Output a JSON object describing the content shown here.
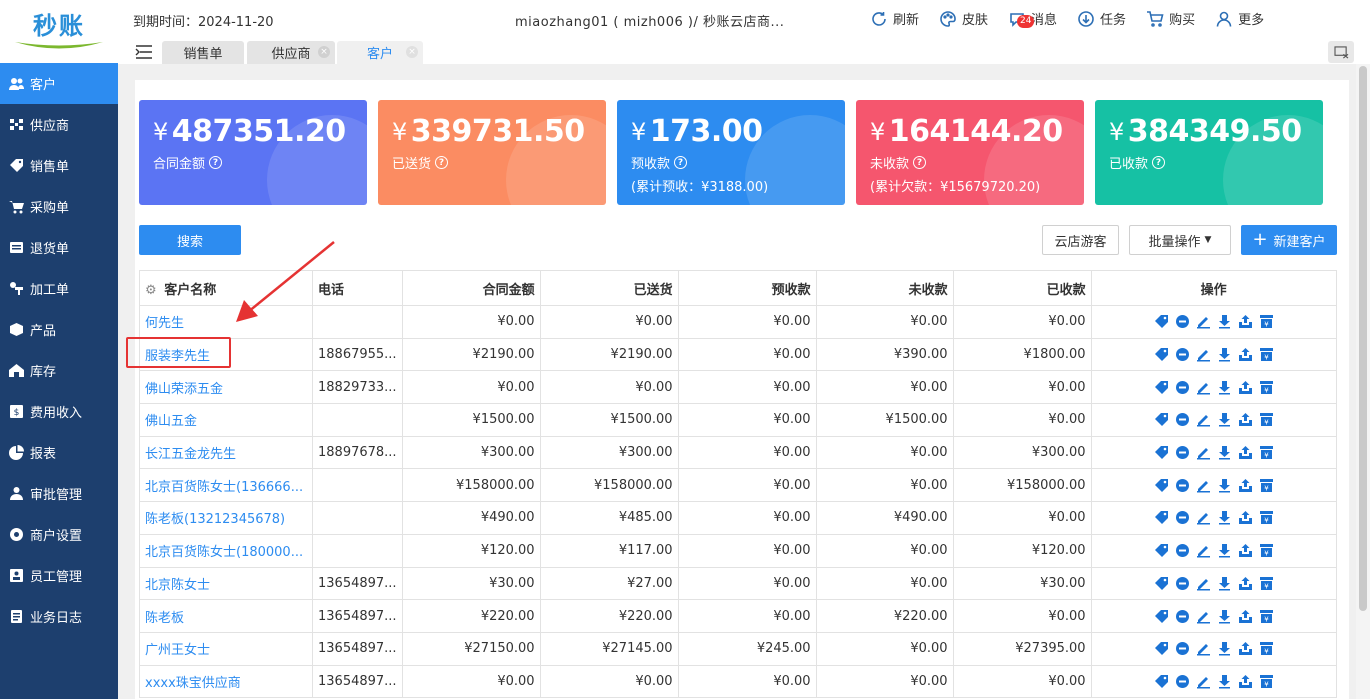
{
  "logo": {
    "text": "秒账"
  },
  "sidebar": {
    "items": [
      {
        "label": "客户",
        "icon": "users-icon",
        "active": true
      },
      {
        "label": "供应商",
        "icon": "supplier-icon"
      },
      {
        "label": "销售单",
        "icon": "tag-icon"
      },
      {
        "label": "采购单",
        "icon": "cart-icon"
      },
      {
        "label": "退货单",
        "icon": "return-icon"
      },
      {
        "label": "加工单",
        "icon": "process-icon"
      },
      {
        "label": "产品",
        "icon": "box-icon"
      },
      {
        "label": "库存",
        "icon": "warehouse-icon"
      },
      {
        "label": "费用收入",
        "icon": "expense-icon"
      },
      {
        "label": "报表",
        "icon": "pie-icon"
      },
      {
        "label": "审批管理",
        "icon": "approve-icon"
      },
      {
        "label": "商户设置",
        "icon": "gear-icon"
      },
      {
        "label": "员工管理",
        "icon": "staff-icon"
      },
      {
        "label": "业务日志",
        "icon": "log-icon"
      }
    ]
  },
  "header": {
    "expiry": "到期时间：2024-11-20",
    "account": "miaozhang01 ( mizh006 )/ 秒账云店商...",
    "tools": {
      "refresh": "刷新",
      "skin": "皮肤",
      "messages": "消息",
      "message_count": "24",
      "tasks": "任务",
      "buy": "购买",
      "more": "更多"
    }
  },
  "tabs": [
    {
      "label": "销售单"
    },
    {
      "label": "供应商"
    },
    {
      "label": "客户",
      "active": true
    }
  ],
  "cards": [
    {
      "currency": "¥",
      "amount": "487351.20",
      "label": "合同金额",
      "color": "#5b74f3"
    },
    {
      "currency": "¥",
      "amount": "339731.50",
      "label": "已送货",
      "color": "#fb8c62"
    },
    {
      "currency": "¥",
      "amount": "173.00",
      "label": "预收款",
      "sub": "(累计预收：¥3188.00)",
      "color": "#2d8cf0"
    },
    {
      "currency": "¥",
      "amount": "164144.20",
      "label": "未收款",
      "sub": "(累计欠款：¥15679720.20)",
      "color": "#f5566e"
    },
    {
      "currency": "¥",
      "amount": "384349.50",
      "label": "已收款",
      "color": "#16c1a4"
    }
  ],
  "actions": {
    "search": "搜索",
    "cloud_guest": "云店游客",
    "batch": "批量操作",
    "new_customer": "新建客户"
  },
  "table": {
    "columns": [
      "客户名称",
      "电话",
      "合同金额",
      "已送货",
      "预收款",
      "未收款",
      "已收款",
      "操作"
    ],
    "rows": [
      [
        "何先生",
        "",
        "¥0.00",
        "¥0.00",
        "¥0.00",
        "¥0.00",
        "¥0.00"
      ],
      [
        "服装李先生",
        "18867955...",
        "¥2190.00",
        "¥2190.00",
        "¥0.00",
        "¥390.00",
        "¥1800.00"
      ],
      [
        "佛山荣添五金",
        "18829733...",
        "¥0.00",
        "¥0.00",
        "¥0.00",
        "¥0.00",
        "¥0.00"
      ],
      [
        "佛山五金",
        "",
        "¥1500.00",
        "¥1500.00",
        "¥0.00",
        "¥1500.00",
        "¥0.00"
      ],
      [
        "长江五金龙先生",
        "18897678...",
        "¥300.00",
        "¥300.00",
        "¥0.00",
        "¥0.00",
        "¥300.00"
      ],
      [
        "北京百货陈女士(136666...",
        "",
        "¥158000.00",
        "¥158000.00",
        "¥0.00",
        "¥0.00",
        "¥158000.00"
      ],
      [
        "陈老板(13212345678)",
        "",
        "¥490.00",
        "¥485.00",
        "¥0.00",
        "¥490.00",
        "¥0.00"
      ],
      [
        "北京百货陈女士(180000...",
        "",
        "¥120.00",
        "¥117.00",
        "¥0.00",
        "¥0.00",
        "¥120.00"
      ],
      [
        "北京陈女士",
        "13654897...",
        "¥30.00",
        "¥27.00",
        "¥0.00",
        "¥0.00",
        "¥30.00"
      ],
      [
        "陈老板",
        "13654897...",
        "¥220.00",
        "¥220.00",
        "¥0.00",
        "¥220.00",
        "¥0.00"
      ],
      [
        "广州王女士",
        "13654897...",
        "¥27150.00",
        "¥27145.00",
        "¥245.00",
        "¥0.00",
        "¥27395.00"
      ],
      [
        "xxxx珠宝供应商",
        "13654897...",
        "¥0.00",
        "¥0.00",
        "¥0.00",
        "¥0.00",
        "¥0.00"
      ]
    ]
  },
  "colors": {
    "accent": "#2d8cf0",
    "sidebar": "#1d3f6e",
    "highlight": "#e53333"
  }
}
